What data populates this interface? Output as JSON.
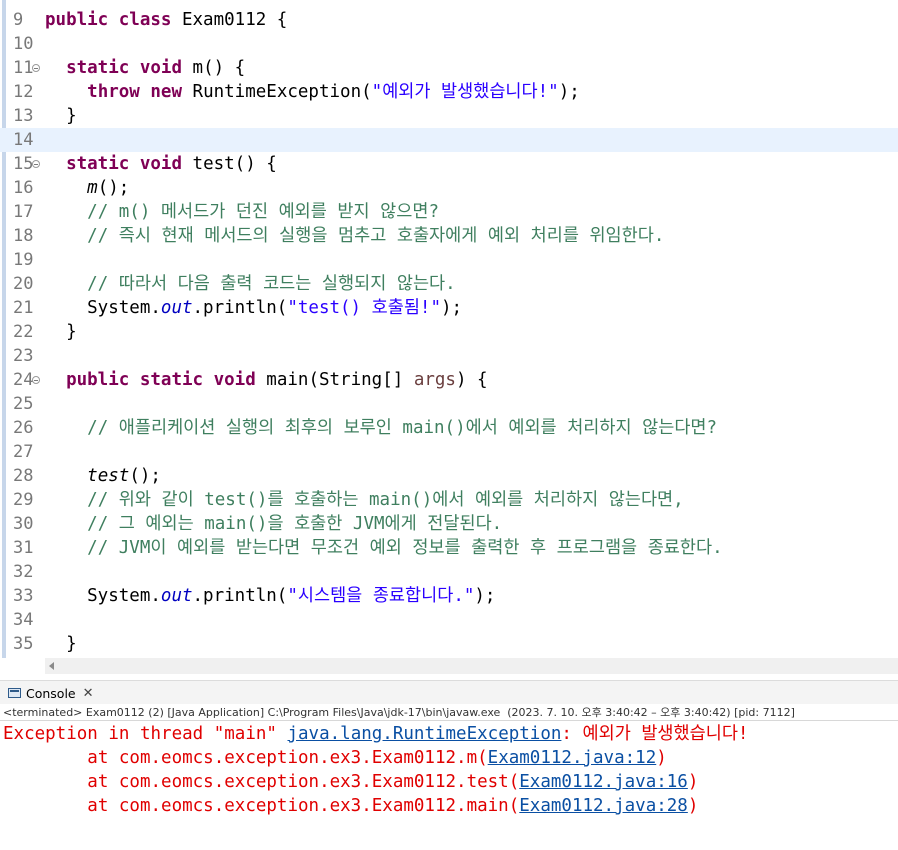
{
  "editor": {
    "lines": [
      {
        "n": "9",
        "code": [
          {
            "t": "kw",
            "v": "public"
          },
          {
            "t": "pl",
            "v": " "
          },
          {
            "t": "kw",
            "v": "class"
          },
          {
            "t": "pl",
            "v": " Exam0112 {"
          }
        ]
      },
      {
        "n": "10",
        "code": []
      },
      {
        "n": "11",
        "fold": true,
        "code": [
          {
            "t": "pl",
            "v": "  "
          },
          {
            "t": "kw",
            "v": "static"
          },
          {
            "t": "pl",
            "v": " "
          },
          {
            "t": "kw",
            "v": "void"
          },
          {
            "t": "pl",
            "v": " m() {"
          }
        ]
      },
      {
        "n": "12",
        "code": [
          {
            "t": "pl",
            "v": "    "
          },
          {
            "t": "kw",
            "v": "throw"
          },
          {
            "t": "pl",
            "v": " "
          },
          {
            "t": "kw",
            "v": "new"
          },
          {
            "t": "pl",
            "v": " RuntimeException("
          },
          {
            "t": "str",
            "v": "\"예외가 발생했습니다!\""
          },
          {
            "t": "pl",
            "v": ");"
          }
        ]
      },
      {
        "n": "13",
        "code": [
          {
            "t": "pl",
            "v": "  }"
          }
        ]
      },
      {
        "n": "14",
        "current": true,
        "code": []
      },
      {
        "n": "15",
        "fold": true,
        "code": [
          {
            "t": "pl",
            "v": "  "
          },
          {
            "t": "kw",
            "v": "static"
          },
          {
            "t": "pl",
            "v": " "
          },
          {
            "t": "kw",
            "v": "void"
          },
          {
            "t": "pl",
            "v": " test() {"
          }
        ]
      },
      {
        "n": "16",
        "code": [
          {
            "t": "pl",
            "v": "    "
          },
          {
            "t": "st",
            "v": "m"
          },
          {
            "t": "pl",
            "v": "();"
          }
        ]
      },
      {
        "n": "17",
        "code": [
          {
            "t": "pl",
            "v": "    "
          },
          {
            "t": "cm",
            "v": "// m() 메서드가 던진 예외를 받지 않으면?"
          }
        ]
      },
      {
        "n": "18",
        "code": [
          {
            "t": "pl",
            "v": "    "
          },
          {
            "t": "cm",
            "v": "// 즉시 현재 메서드의 실행을 멈추고 호출자에게 예외 처리를 위임한다."
          }
        ]
      },
      {
        "n": "19",
        "code": []
      },
      {
        "n": "20",
        "code": [
          {
            "t": "pl",
            "v": "    "
          },
          {
            "t": "cm",
            "v": "// 따라서 다음 출력 코드는 실행되지 않는다."
          }
        ]
      },
      {
        "n": "21",
        "code": [
          {
            "t": "pl",
            "v": "    System."
          },
          {
            "t": "fld",
            "v": "out"
          },
          {
            "t": "pl",
            "v": ".println("
          },
          {
            "t": "str",
            "v": "\"test() 호출됨!\""
          },
          {
            "t": "pl",
            "v": ");"
          }
        ]
      },
      {
        "n": "22",
        "code": [
          {
            "t": "pl",
            "v": "  }"
          }
        ]
      },
      {
        "n": "23",
        "code": []
      },
      {
        "n": "24",
        "fold": true,
        "code": [
          {
            "t": "pl",
            "v": "  "
          },
          {
            "t": "kw",
            "v": "public"
          },
          {
            "t": "pl",
            "v": " "
          },
          {
            "t": "kw",
            "v": "static"
          },
          {
            "t": "pl",
            "v": " "
          },
          {
            "t": "kw",
            "v": "void"
          },
          {
            "t": "pl",
            "v": " main(String[] "
          },
          {
            "t": "prm",
            "v": "args"
          },
          {
            "t": "pl",
            "v": ") {"
          }
        ]
      },
      {
        "n": "25",
        "code": []
      },
      {
        "n": "26",
        "code": [
          {
            "t": "pl",
            "v": "    "
          },
          {
            "t": "cm",
            "v": "// 애플리케이션 실행의 최후의 보루인 main()에서 예외를 처리하지 않는다면?"
          }
        ]
      },
      {
        "n": "27",
        "code": []
      },
      {
        "n": "28",
        "code": [
          {
            "t": "pl",
            "v": "    "
          },
          {
            "t": "st",
            "v": "test"
          },
          {
            "t": "pl",
            "v": "();"
          }
        ]
      },
      {
        "n": "29",
        "code": [
          {
            "t": "pl",
            "v": "    "
          },
          {
            "t": "cm",
            "v": "// 위와 같이 test()를 호출하는 main()에서 예외를 처리하지 않는다면,"
          }
        ]
      },
      {
        "n": "30",
        "code": [
          {
            "t": "pl",
            "v": "    "
          },
          {
            "t": "cm",
            "v": "// 그 예외는 main()을 호출한 JVM에게 전달된다."
          }
        ]
      },
      {
        "n": "31",
        "code": [
          {
            "t": "pl",
            "v": "    "
          },
          {
            "t": "cm",
            "v": "// JVM이 예외를 받는다면 무조건 예외 정보를 출력한 후 프로그램을 종료한다."
          }
        ]
      },
      {
        "n": "32",
        "code": []
      },
      {
        "n": "33",
        "code": [
          {
            "t": "pl",
            "v": "    System."
          },
          {
            "t": "fld",
            "v": "out"
          },
          {
            "t": "pl",
            "v": ".println("
          },
          {
            "t": "str",
            "v": "\"시스템을 종료합니다.\""
          },
          {
            "t": "pl",
            "v": ");"
          }
        ]
      },
      {
        "n": "34",
        "code": []
      },
      {
        "n": "35",
        "code": [
          {
            "t": "pl",
            "v": "  }"
          }
        ]
      }
    ]
  },
  "console": {
    "tab_label": "Console",
    "status": "<terminated> Exam0112 (2) [Java Application] C:\\Program Files\\Java\\jdk-17\\bin\\javaw.exe  (2023. 7. 10. 오후 3:40:42 – 오후 3:40:42) [pid: 7112]",
    "output": [
      [
        {
          "t": "err",
          "v": "Exception in thread \"main\" "
        },
        {
          "t": "link",
          "v": "java.lang.RuntimeException"
        },
        {
          "t": "err",
          "v": ": 예외가 발생했습니다!"
        }
      ],
      [
        {
          "t": "err",
          "v": "        at com.eomcs.exception.ex3.Exam0112.m("
        },
        {
          "t": "link",
          "v": "Exam0112.java:12"
        },
        {
          "t": "err",
          "v": ")"
        }
      ],
      [
        {
          "t": "err",
          "v": "        at com.eomcs.exception.ex3.Exam0112.test("
        },
        {
          "t": "link",
          "v": "Exam0112.java:16"
        },
        {
          "t": "err",
          "v": ")"
        }
      ],
      [
        {
          "t": "err",
          "v": "        at com.eomcs.exception.ex3.Exam0112.main("
        },
        {
          "t": "link",
          "v": "Exam0112.java:28"
        },
        {
          "t": "err",
          "v": ")"
        }
      ]
    ]
  },
  "colors": {
    "keyword": "#7f0055",
    "string": "#2a00ff",
    "comment": "#3f7f5f",
    "field": "#0000c0",
    "error": "#e00000",
    "link": "#0a4fa3",
    "current_line": "#e8f2fe"
  },
  "icons": {
    "fold": "collapse-marker-icon",
    "console": "console-icon",
    "close": "close-icon",
    "scroll_left": "scroll-left-arrow-icon"
  }
}
